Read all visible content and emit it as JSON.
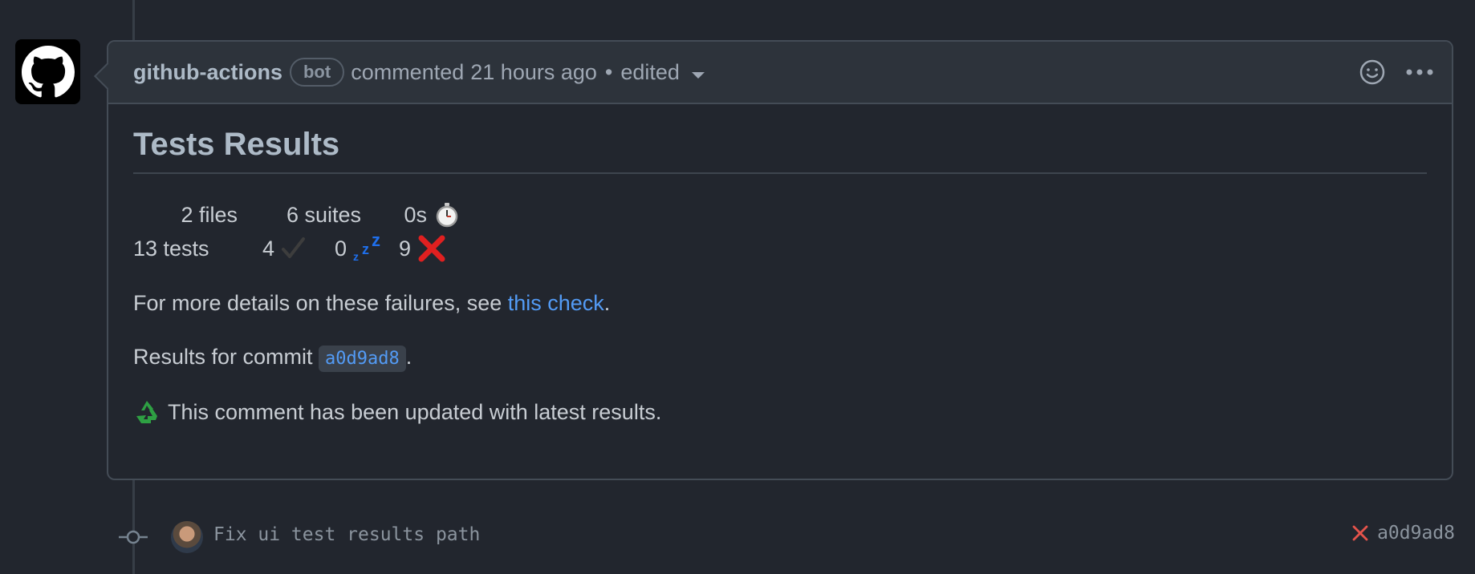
{
  "comment": {
    "author": "github-actions",
    "badge": "bot",
    "action": "commented",
    "time": "21 hours ago",
    "separator": "•",
    "edited": "edited",
    "title": "Tests Results",
    "stats": {
      "files": "2 files",
      "suites": "6 suites",
      "duration": "0s",
      "tests": "13 tests",
      "passed": "4",
      "skipped": "0",
      "failed": "9"
    },
    "details_prefix": "For more details on these failures, see ",
    "details_link": "this check",
    "details_suffix": ".",
    "commit_prefix": "Results for commit ",
    "commit_sha": "a0d9ad8",
    "commit_suffix": ".",
    "updated_note": "This comment has been updated with latest results.",
    "icons": {
      "reaction": "smiley-icon",
      "menu": "kebab-menu-icon",
      "duration": "stopwatch-icon",
      "passed": "check-icon",
      "skipped": "zzz-icon",
      "failed": "cross-icon",
      "updated": "recycle-icon"
    }
  },
  "commit": {
    "message": "Fix ui test results path",
    "sha": "a0d9ad8",
    "status": "failed",
    "status_icon": "x-icon"
  },
  "colors": {
    "background": "#22262e",
    "link": "#539bf5",
    "fail": "#e5534b",
    "skip": "#1f6feb"
  }
}
